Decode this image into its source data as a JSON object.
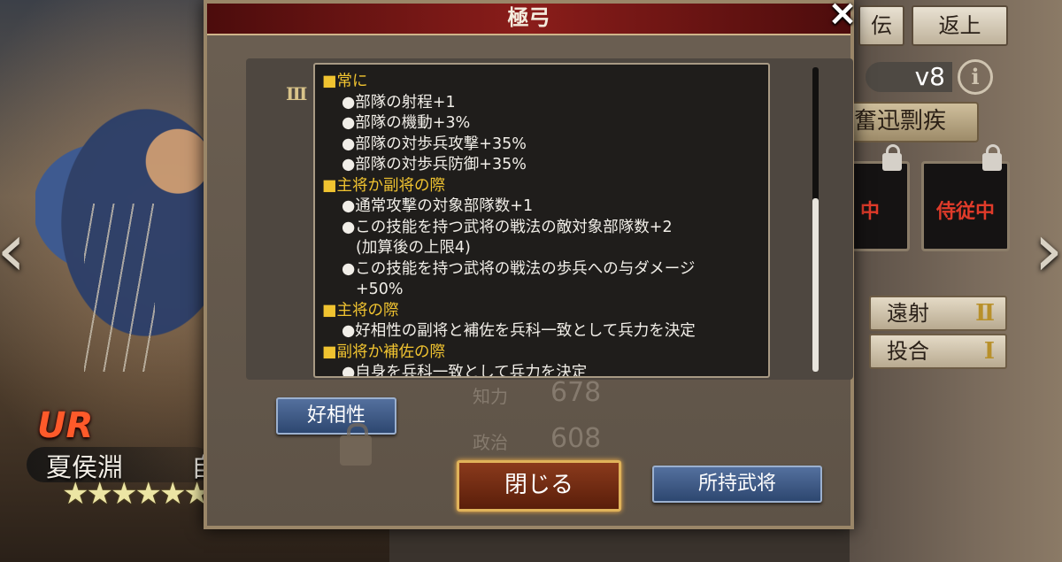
{
  "modal": {
    "title": "極弓",
    "close_icon": "×",
    "level_mark": "Ⅲ",
    "lines": [
      {
        "type": "head",
        "text": "常に"
      },
      {
        "type": "item",
        "text": "部隊の射程+1"
      },
      {
        "type": "item",
        "text": "部隊の機動+3%"
      },
      {
        "type": "item",
        "text": "部隊の対歩兵攻撃+35%"
      },
      {
        "type": "item",
        "text": "部隊の対歩兵防御+35%"
      },
      {
        "type": "head",
        "text": "主将か副将の際"
      },
      {
        "type": "item",
        "text": "通常攻撃の対象部隊数+1"
      },
      {
        "type": "item",
        "text": "この技能を持つ武将の戦法の敵対象部隊数+2"
      },
      {
        "type": "cont",
        "text": "(加算後の上限4)"
      },
      {
        "type": "item",
        "text": "この技能を持つ武将の戦法の歩兵への与ダメージ"
      },
      {
        "type": "cont",
        "text": "+50%"
      },
      {
        "type": "head",
        "text": "主将の際"
      },
      {
        "type": "item",
        "text": "好相性の副将と補佐を兵科一致として兵力を決定"
      },
      {
        "type": "head",
        "text": "副将か補佐の際"
      },
      {
        "type": "item",
        "text": "自身を兵科一致として兵力を決定"
      }
    ],
    "aishou_label": "好相性",
    "close_label": "閉じる",
    "shoji_label": "所持武将",
    "ghost_stats": [
      {
        "label": "知力",
        "value": "678"
      },
      {
        "label": "政治",
        "value": "608"
      }
    ]
  },
  "background": {
    "rarity": "UR",
    "general_name": "夏侯淵",
    "general_name_extra": "自",
    "stars_on": 6,
    "stars_total": 8,
    "tabs": [
      "伝",
      "返上"
    ],
    "level": "v8",
    "info_icon": "i",
    "skill_name": "奮迅剽疾",
    "slot_status": [
      "中",
      "侍従中"
    ],
    "right_skills": [
      {
        "label": "遠射",
        "level": "Ⅱ"
      },
      {
        "label": "投合",
        "level": "Ⅰ"
      }
    ],
    "nav_left": "‹",
    "nav_right": "›"
  }
}
